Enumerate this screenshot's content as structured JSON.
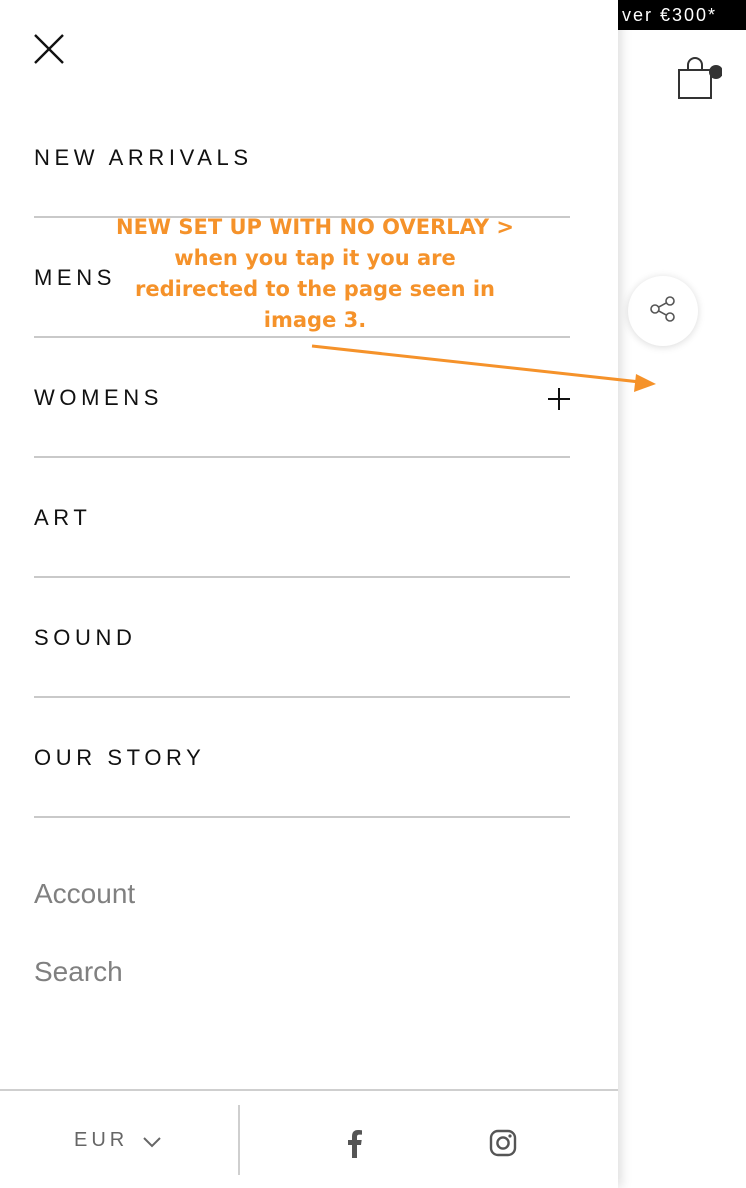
{
  "promo": {
    "text": "ver €300*"
  },
  "menu": {
    "items": [
      {
        "label": "NEW ARRIVALS",
        "expandable": false
      },
      {
        "label": "MENS",
        "expandable": false
      },
      {
        "label": "WOMENS",
        "expandable": true
      },
      {
        "label": "ART",
        "expandable": false
      },
      {
        "label": "SOUND",
        "expandable": false
      },
      {
        "label": "OUR STORY",
        "expandable": false
      }
    ],
    "secondary": {
      "account": "Account",
      "search": "Search"
    }
  },
  "footer": {
    "currency": "EUR"
  },
  "annotation": {
    "line1": "NEW SET UP WITH NO OVERLAY >",
    "line2": "when you tap it you are",
    "line3": "redirected to the page seen in",
    "line4": "image 3."
  },
  "colors": {
    "annotation": "#f5922a",
    "divider": "#c9c9c9",
    "text": "#111111",
    "muted": "#808080"
  },
  "icons": [
    "close-icon",
    "plus-icon",
    "cart-icon",
    "share-icon",
    "chevron-down-icon",
    "facebook-icon",
    "instagram-icon"
  ]
}
